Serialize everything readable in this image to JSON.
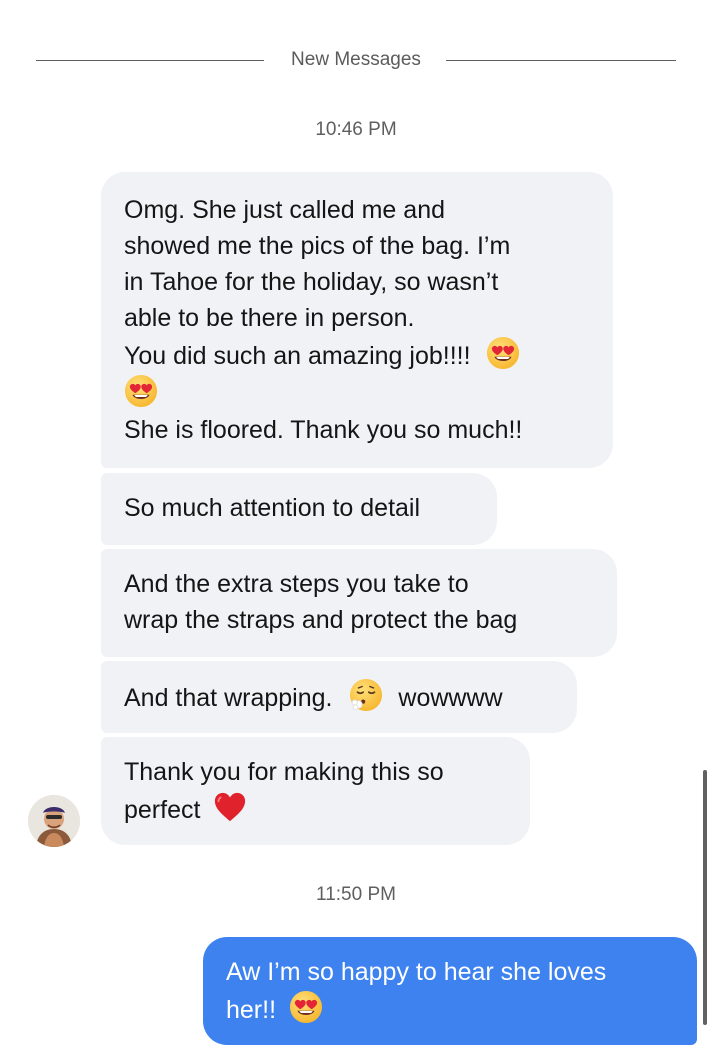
{
  "divider": {
    "label": "New Messages"
  },
  "timestamps": [
    "10:46 PM",
    "11:50 PM"
  ],
  "incoming": [
    {
      "lines": [
        "Omg. She just called me and",
        "showed me the pics of the bag. I’m",
        "in Tahoe for the holiday, so wasn’t",
        "able to be there in person.",
        "You did such an amazing job!!!!",
        "She is floored. Thank you so much!!"
      ]
    },
    {
      "text": "So much attention to detail"
    },
    {
      "lines": [
        "And the extra steps you take to",
        "wrap the straps and protect the bag"
      ]
    },
    {
      "text_before": "And that wrapping.",
      "text_after": "wowwww"
    },
    {
      "lines": [
        "Thank you for making this so",
        "perfect"
      ]
    }
  ],
  "outgoing": [
    {
      "lines": [
        "Aw I’m so happy to hear she loves",
        "her!!"
      ]
    }
  ],
  "icons": {
    "heart_eyes": "smiling-face-with-heart-eyes",
    "exhale": "face-exhaling",
    "heart": "red-heart"
  },
  "colors": {
    "incoming_bubble": "#f1f2f6",
    "outgoing_bubble": "#3d82ef",
    "heart": "#e0222c",
    "emoji_face": "#ffc83d"
  }
}
